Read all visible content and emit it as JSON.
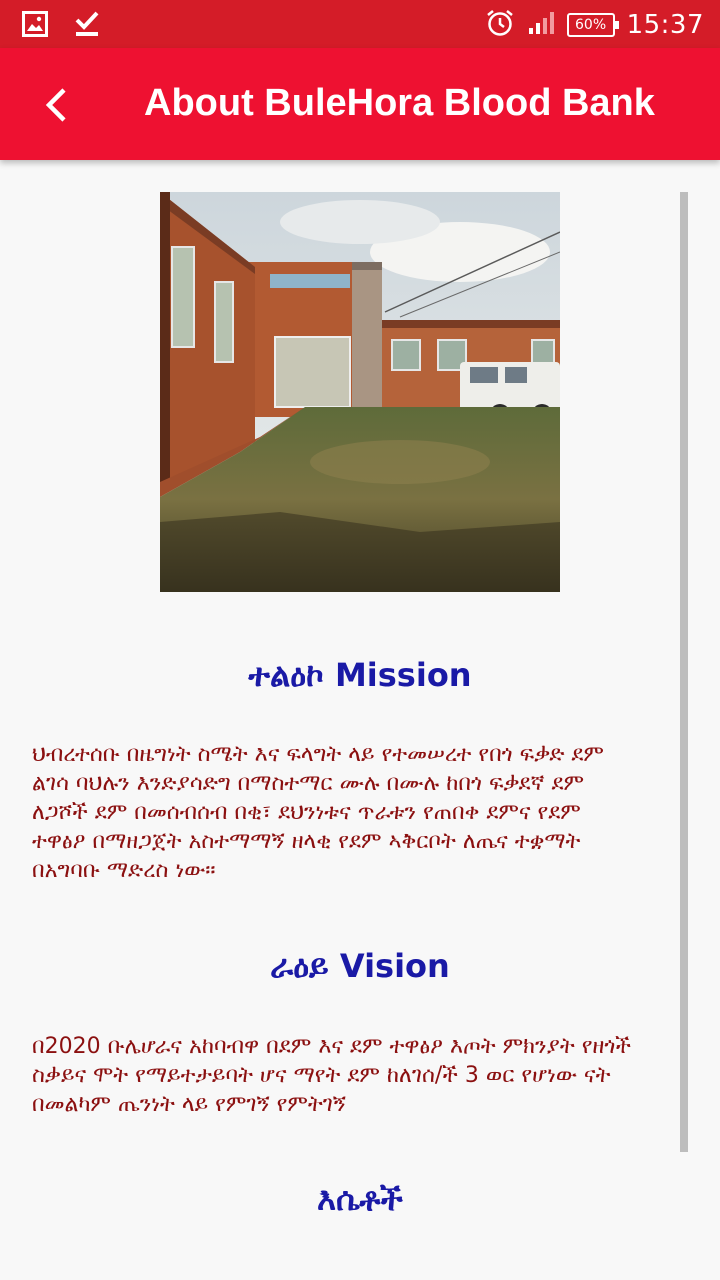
{
  "status_bar": {
    "time": "15:37",
    "battery": "60%",
    "icons": [
      "image-icon",
      "download-done-icon",
      "alarm-icon",
      "signal-icon",
      "battery-icon"
    ]
  },
  "app_bar": {
    "back_icon": "arrow-back-icon",
    "title": "About BuleHora Blood Bank",
    "color": "#ee1131"
  },
  "content": {
    "mission_heading": "ተልዕኮ Mission",
    "mission_text": "ህብረተሰቡ በዜግነት ስሜት እና ፍላግት ላይ የተመሠረተ የበጎ ፍቃድ ደም\nልገሳ ባህሉን እንድያሳድግ በማስተማር ሙሉ በሙሉ ከበጎ ፍቃደኛ ደም\nለጋሾች ደም በመሰብሰብ በቂ፣ ደህንነቱና ጥራቱን የጠበቀ ደምና የደም\nተዋፅዖ በማዘጋጀት አስተማማኝ ዘላቂ የደም ኣቅርቦት ለጤና ተቋማት\nበአግባቡ ማድረስ ነው።",
    "vision_heading": "ራዕይ Vision",
    "vision_text": "በ2020 ቡሌሆራና አከባብዋ በደም እና ደም ተዋፅዖ እጦት ምክንያት የዘጎች\nስቃይና ሞት የማይተታይባት ሆና ማየት ደም ከለገሰ/ች 3 ወር የሆነው ናት\nበመልካም ጤንነት ላይ የምገኝ የምትገኝ",
    "values_heading": "እሴቶች"
  }
}
